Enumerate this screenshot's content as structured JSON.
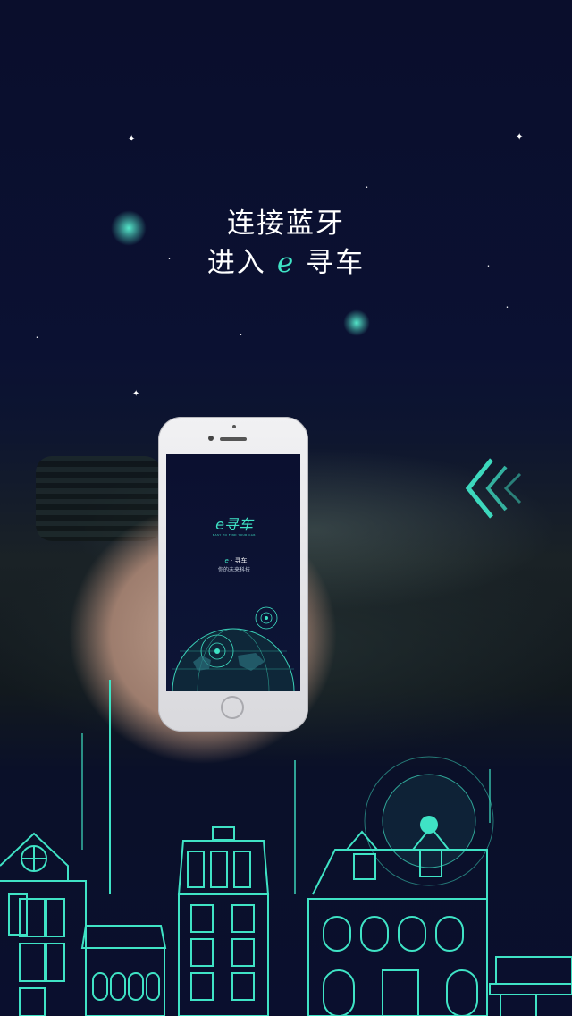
{
  "headline": {
    "line1": "连接蓝牙",
    "line2_prefix": "进入",
    "line2_brand": "e",
    "line2_suffix": "寻车"
  },
  "phone_screen": {
    "logo_text": "e寻车",
    "logo_tagline": "EASY TO FIND YOUR CAR",
    "brand_letter": "e",
    "brand_name": "· 寻车",
    "slogan": "你的未来科技"
  },
  "colors": {
    "accent": "#3fe3c5",
    "background": "#0b1030"
  },
  "icons": [
    "swipe-left-chevrons-icon",
    "globe-radar-icon",
    "city-skyline-illustration"
  ]
}
